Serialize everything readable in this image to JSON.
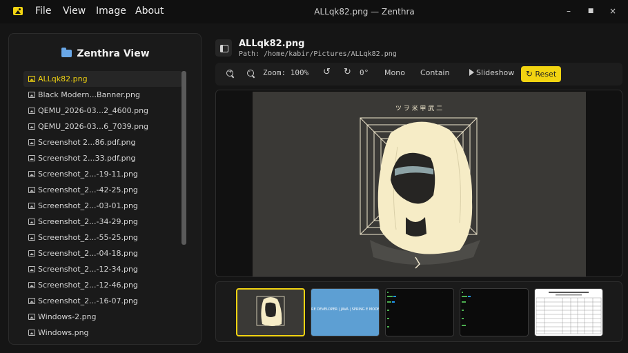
{
  "app": {
    "icon": "image-icon",
    "accent": "#f2d411"
  },
  "menu": [
    "File",
    "View",
    "Image",
    "About"
  ],
  "window": {
    "title": "ALLqk82.png — Zenthra",
    "controls": [
      "–",
      "■",
      "×"
    ]
  },
  "sidebar": {
    "title": "Zenthra View",
    "title_icon": "folder-icon",
    "files": [
      "ALLqk82.png",
      "Black Modern...Banner.png",
      "QEMU_2026-03...2_4600.png",
      "QEMU_2026-03...6_7039.png",
      "Screenshot 2...86.pdf.png",
      "Screenshot 2...33.pdf.png",
      "Screenshot_2...-19-11.png",
      "Screenshot_2...-42-25.png",
      "Screenshot_2...-03-01.png",
      "Screenshot_2...-34-29.png",
      "Screenshot_2...-55-25.png",
      "Screenshot_2...-04-18.png",
      "Screenshot_2...-12-34.png",
      "Screenshot_2...-12-46.png",
      "Screenshot_2...-16-07.png",
      "Windows-2.png",
      "Windows.png"
    ],
    "selected_index": 0
  },
  "header": {
    "file_name": "ALLqk82.png",
    "path": "Path: /home/kabir/Pictures/ALLqk82.png"
  },
  "toolbar": {
    "zoom_label": "Zoom: 100%",
    "rotation": "0°",
    "mono": "Mono",
    "fit": "Contain",
    "slideshow": "Slideshow",
    "reset": "Reset"
  },
  "artwork": {
    "glyphs": "ツ ヲ 米 甲 武 二"
  },
  "thumbnails": [
    {
      "name": "ALLqk82.png",
      "selected": true
    },
    {
      "name": "Black Modern...Banner.png",
      "text": "RE DEVELOPER | JAVA | SPRING E MODE.JS | SCALABLE APIS"
    },
    {
      "name": "QEMU_2026-03...2_4600.png"
    },
    {
      "name": "QEMU_2026-03...6_7039.png"
    },
    {
      "name": "Screenshot 2...86.pdf.png"
    }
  ]
}
